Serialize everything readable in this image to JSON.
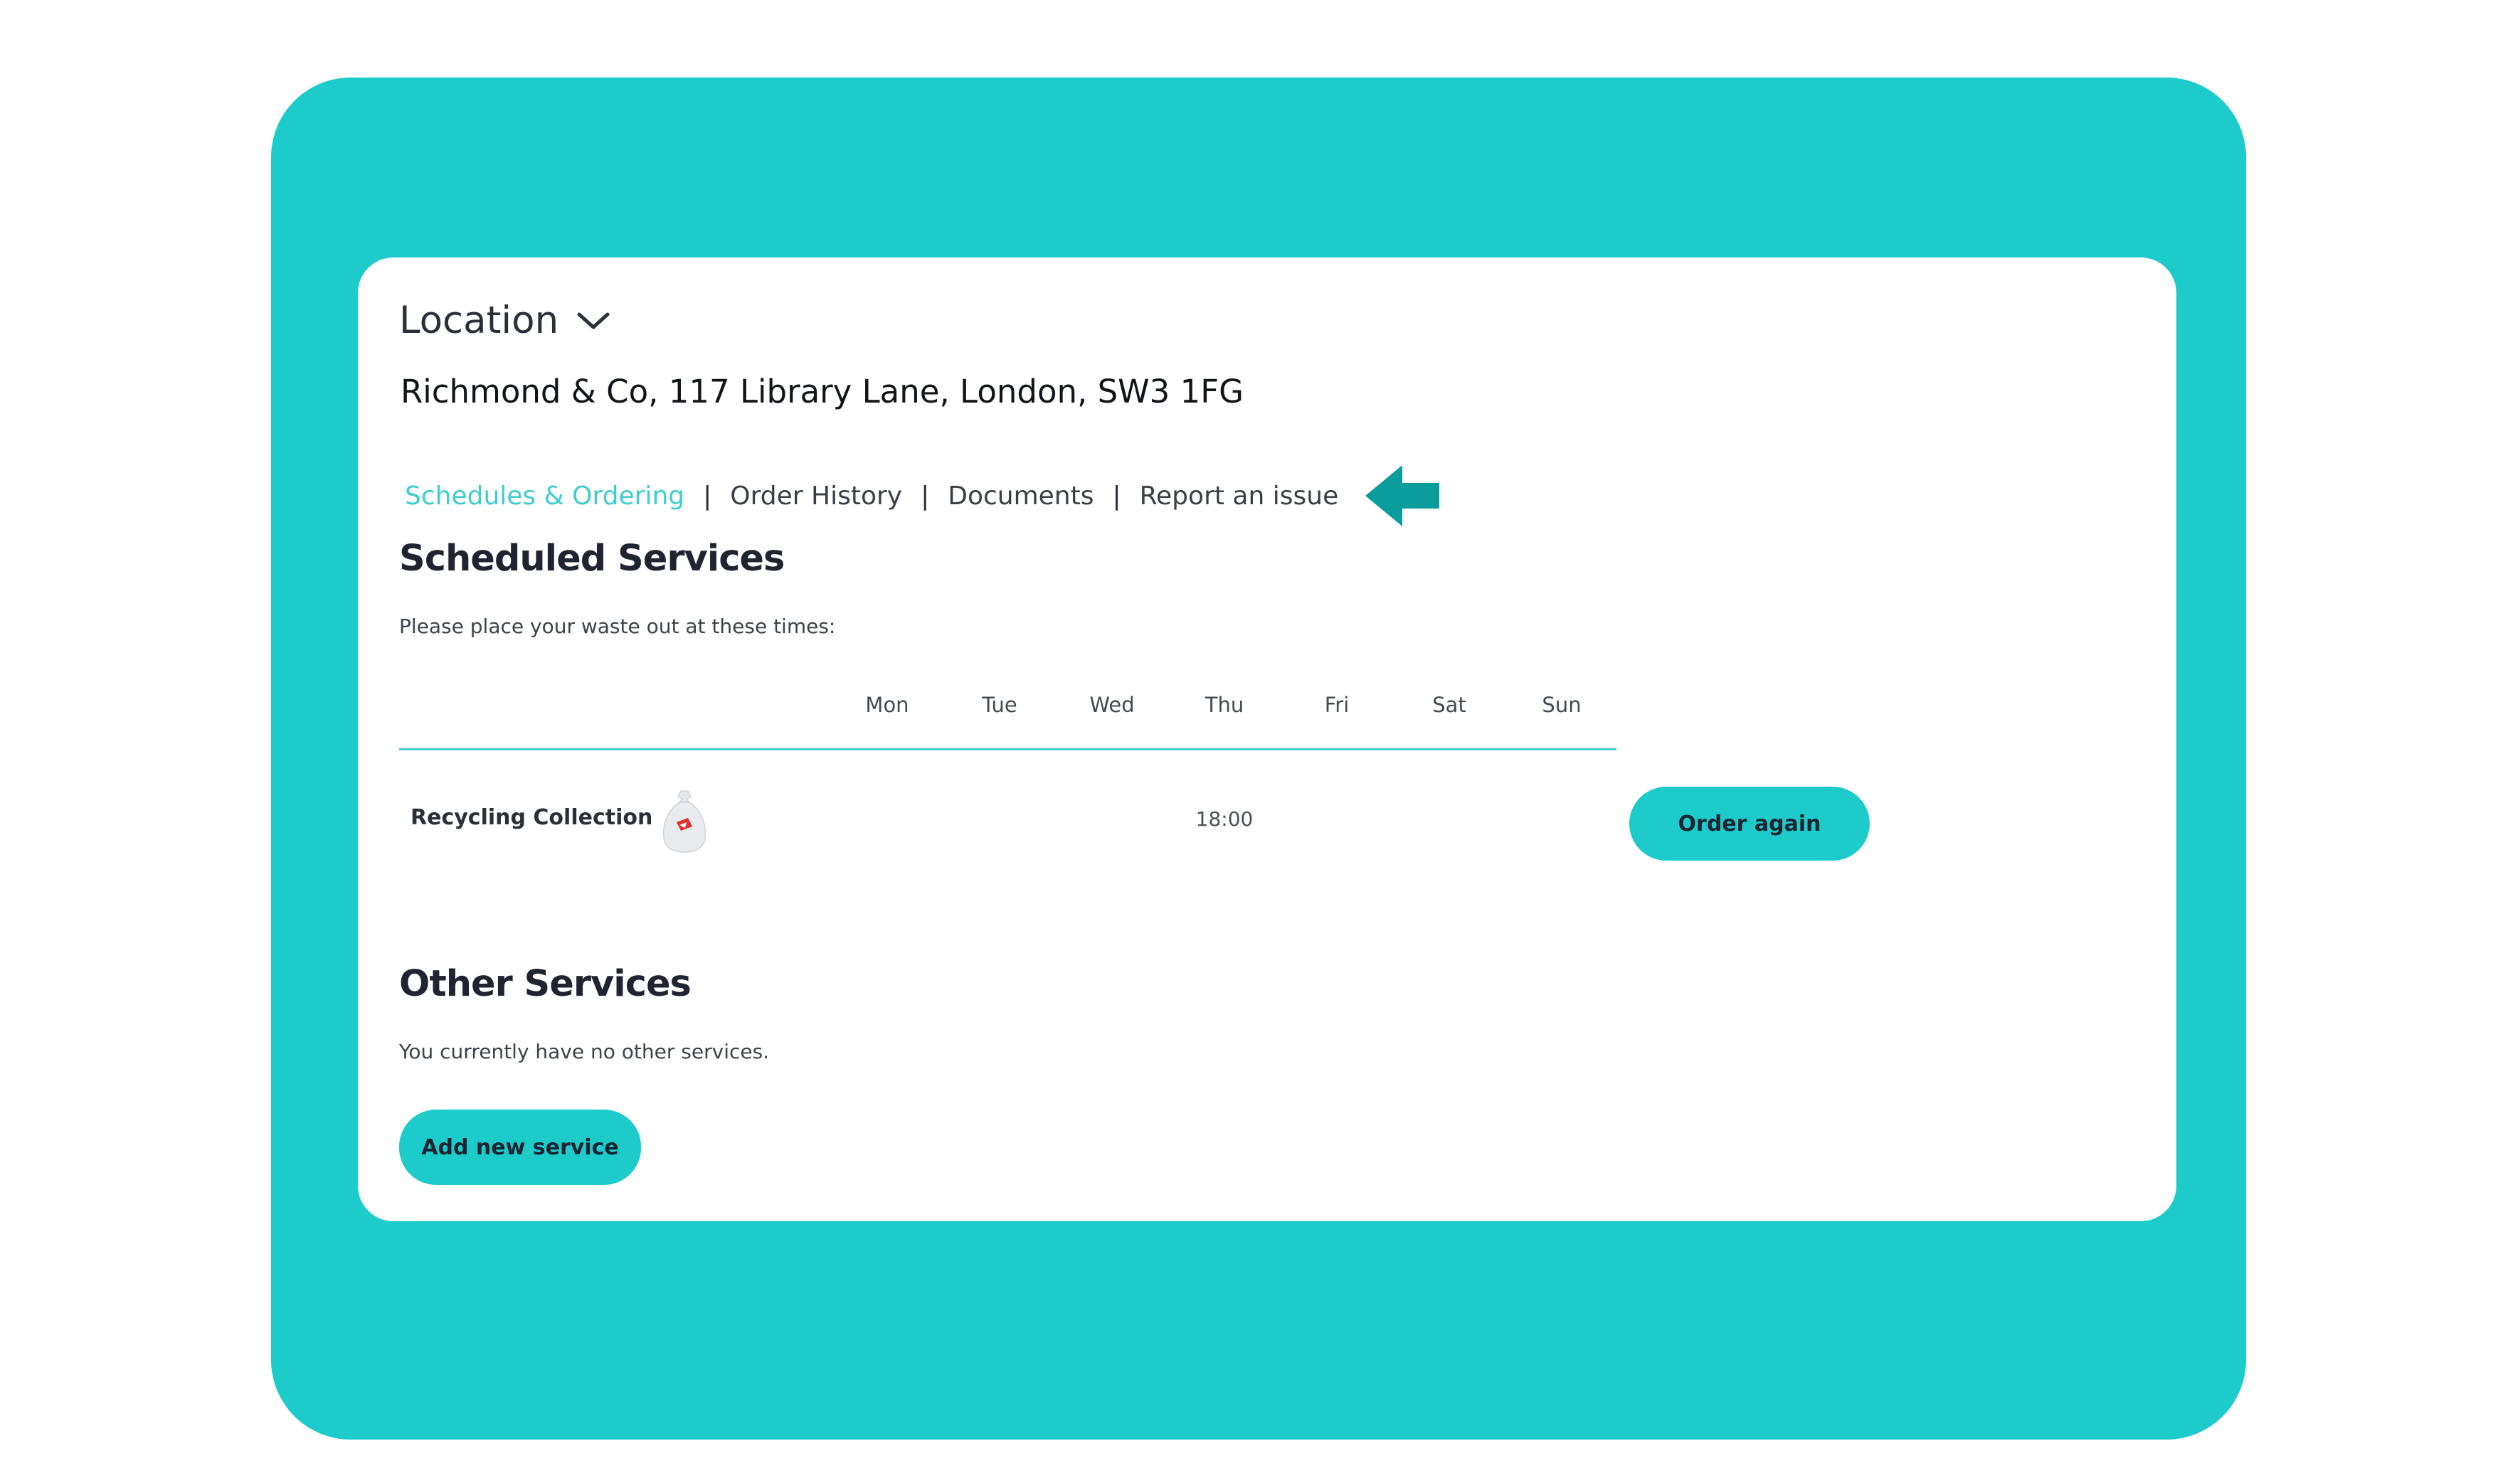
{
  "location": {
    "label": "Location",
    "address": "Richmond & Co, 117 Library Lane, London, SW3 1FG"
  },
  "nav": {
    "tabs": [
      {
        "label": "Schedules & Ordering",
        "active": true
      },
      {
        "label": "Order History",
        "active": false
      },
      {
        "label": "Documents",
        "active": false
      },
      {
        "label": "Report an issue",
        "active": false
      }
    ],
    "separator": "|",
    "pointer_icon": "arrow-left-icon"
  },
  "scheduled": {
    "title": "Scheduled Services",
    "subtitle": "Please place your waste out at these times:",
    "days": [
      "Mon",
      "Tue",
      "Wed",
      "Thu",
      "Fri",
      "Sat",
      "Sun"
    ],
    "services": [
      {
        "name": "Recycling Collection",
        "icon": "waste-bag-icon",
        "day": "Thu",
        "time": "18:00",
        "action_label": "Order again"
      }
    ]
  },
  "other": {
    "title": "Other Services",
    "subtitle": "You currently have no other services.",
    "add_label": "Add new service"
  },
  "colors": {
    "brand_teal": "#1dcbcb",
    "active_link": "#3fcece",
    "arrow": "#0b9c9c",
    "bag_accent": "#e03030"
  }
}
